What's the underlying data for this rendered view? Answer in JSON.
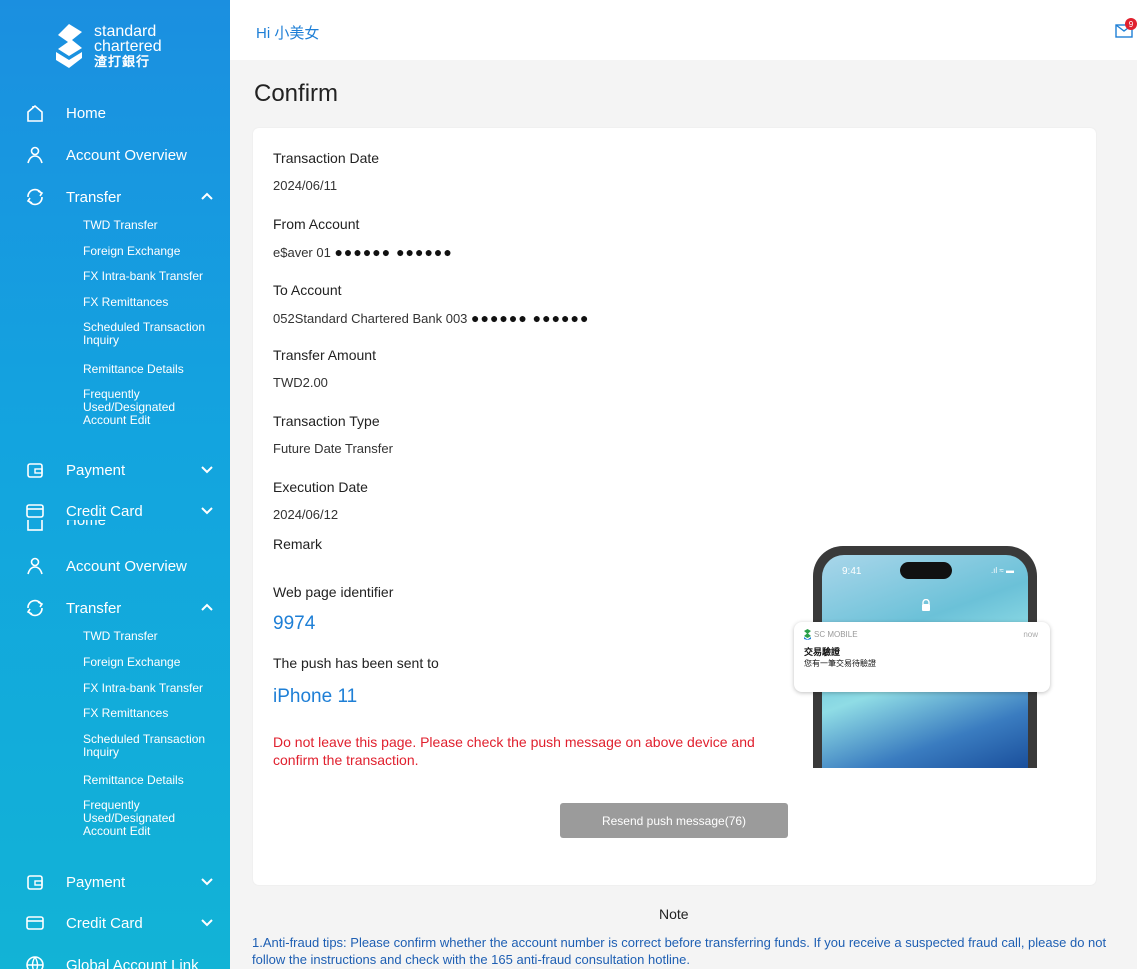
{
  "sidebar": {
    "logo": {
      "line1": "standard",
      "line2": "chartered",
      "zh": "渣打銀行"
    },
    "section1": {
      "home": "Home",
      "account_overview": "Account Overview",
      "transfer": "Transfer",
      "transfer_items": [
        "TWD Transfer",
        "Foreign Exchange",
        "FX Intra-bank Transfer",
        "FX Remittances",
        "Scheduled Transaction Inquiry",
        "Remittance Details",
        "Frequently Used/Designated Account Edit"
      ],
      "payment": "Payment",
      "credit_card": "Credit Card"
    },
    "section2": {
      "home": "Home",
      "account_overview": "Account Overview",
      "transfer": "Transfer",
      "transfer_items": [
        "TWD Transfer",
        "Foreign Exchange",
        "FX Intra-bank Transfer",
        "FX Remittances",
        "Scheduled Transaction Inquiry",
        "Remittance Details",
        "Frequently Used/Designated Account Edit"
      ],
      "payment": "Payment",
      "credit_card": "Credit Card",
      "global_account_link": "Global Account Link"
    }
  },
  "header": {
    "greeting": "Hi 小美女",
    "mail_badge": "9"
  },
  "main": {
    "title": "Confirm",
    "fields": {
      "transaction_date_label": "Transaction Date",
      "transaction_date": "2024/06/11",
      "from_account_label": "From Account",
      "from_account": "e$aver 01",
      "from_account_mask": "●●●●●● ●●●●●●",
      "to_account_label": "To Account",
      "to_account": "052Standard Chartered Bank 003",
      "to_account_mask": "●●●●●● ●●●●●●",
      "transfer_amount_label": "Transfer Amount",
      "transfer_amount": "TWD2.00",
      "transaction_type_label": "Transaction Type",
      "transaction_type": "Future Date Transfer",
      "execution_date_label": "Execution Date",
      "execution_date": "2024/06/12",
      "remark_label": "Remark"
    },
    "identifier_label": "Web page identifier",
    "identifier": "9974",
    "push_label": "The push has been sent to",
    "device": "iPhone 11",
    "warning": "Do not leave this page. Please check the push message on above device and confirm the transaction.",
    "resend_button": "Resend push message(76)",
    "phone": {
      "time": "9:41",
      "status": ".ıl ≈ ▬",
      "app_name": "SC MOBILE",
      "now": "now",
      "notif_title": "交易驗證",
      "notif_body": "您有一筆交易待驗證"
    },
    "note_title": "Note",
    "note_text": "1.Anti-fraud tips: Please confirm whether the account number is correct before transferring funds. If you receive a suspected fraud call, please do not follow the instructions and check with the 165 anti-fraud consultation hotline."
  }
}
